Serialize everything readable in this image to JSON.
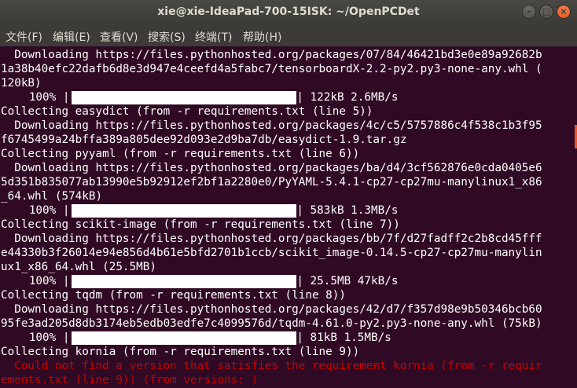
{
  "window": {
    "title": "xie@xie-IdeaPad-700-15ISK: ~/OpenPCDet"
  },
  "menu": [
    "文件(F)",
    "编辑(E)",
    "查看(V)",
    "搜索(S)",
    "终端(T)",
    "帮助(H)"
  ],
  "lines": [
    "  Downloading https://files.pythonhosted.org/packages/07/84/46421bd3e0e89a92682b",
    "1a38b40efc22dafb6d8e3d947e4ceefd4a5fabc7/tensorboardX-2.2-py2.py3-none-any.whl (",
    "120kB)",
    "",
    "Collecting easydict (from -r requirements.txt (line 5))",
    "  Downloading https://files.pythonhosted.org/packages/4c/c5/5757886c4f538c1b3f95",
    "f6745499a24bffa389a805dee92d093e2d9ba7db/easydict-1.9.tar.gz",
    "Collecting pyyaml (from -r requirements.txt (line 6))",
    "  Downloading https://files.pythonhosted.org/packages/ba/d4/3cf562876e0cda0405e6",
    "5d351b835077ab13990e5b92912ef2bf1a2280e0/PyYAML-5.4.1-cp27-cp27mu-manylinux1_x86",
    "_64.whl (574kB)",
    "",
    "Collecting scikit-image (from -r requirements.txt (line 7))",
    "  Downloading https://files.pythonhosted.org/packages/bb/7f/d27fadff2c2b8cd45fff",
    "e44330b3f26014e94e856d4b61e5bfd2701b1ccb/scikit_image-0.14.5-cp27-cp27mu-manylin",
    "ux1_x86_64.whl (25.5MB)",
    "",
    "Collecting tqdm (from -r requirements.txt (line 8))",
    "  Downloading https://files.pythonhosted.org/packages/42/d7/f357d98e9b50346bcb60",
    "95fe3ad205d8db3174eb5edb03edfe7c4099576d/tqdm-4.61.0-py2.py3-none-any.whl (75kB)",
    "",
    "Collecting kornia (from -r requirements.txt (line 9))",
    "  Could not find a version that satisfies the requirement kornia (from -r requir",
    "ements.txt (line 9)) (from versions: )"
  ],
  "progress": [
    {
      "line": 3,
      "percent": "100%",
      "size": "122kB",
      "rate": "2.6MB/s",
      "fraction": 1.0
    },
    {
      "line": 11,
      "percent": "100%",
      "size": "583kB",
      "rate": "1.3MB/s",
      "fraction": 1.0
    },
    {
      "line": 16,
      "percent": "100%",
      "size": "25.5MB",
      "rate": "47kB/s",
      "fraction": 1.0
    },
    {
      "line": 20,
      "percent": "100%",
      "size": "81kB",
      "rate": "1.5MB/s",
      "fraction": 1.0
    }
  ],
  "error_lines": [
    22,
    23
  ],
  "colors": {
    "background": "#300a24",
    "text": "#ffffff",
    "error": "#cc0000",
    "accent": "#e95420"
  }
}
